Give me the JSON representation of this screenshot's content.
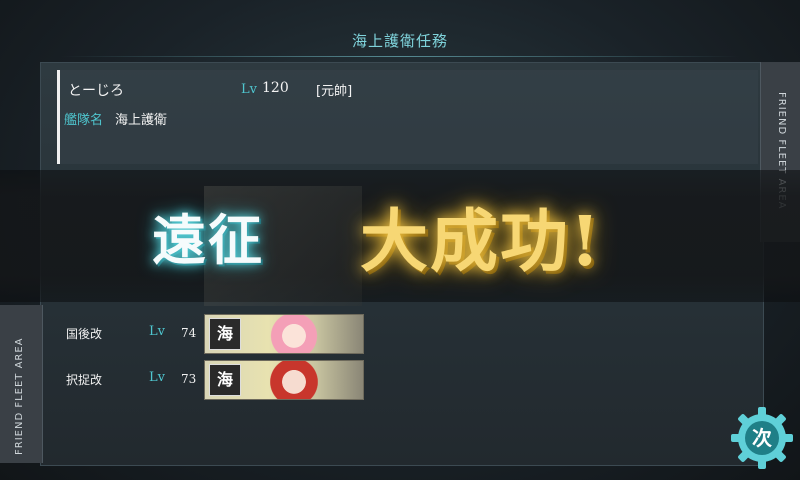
{
  "mission_title": "海上護衛任務",
  "player": {
    "name": "とーじろ",
    "lv_label": "Lv",
    "lv_value": "120",
    "rank": "[元帥]"
  },
  "fleet": {
    "label": "艦隊名",
    "name": "海上護衛"
  },
  "side_labels": {
    "left": "FRIEND FLEET AREA",
    "right": "FRIEND FLEET AREA"
  },
  "result": {
    "expedition": "遠征",
    "great_success": "大成功!"
  },
  "ships": [
    {
      "name": "国後改",
      "lv_label": "Lv",
      "lv": "74",
      "badge": "海防",
      "hair_color": "#f49fb7"
    },
    {
      "name": "択捉改",
      "lv_label": "Lv",
      "lv": "73",
      "badge": "海防",
      "hair_color": "#c8362c"
    }
  ],
  "next_button": {
    "label": "次"
  },
  "colors": {
    "accent_cyan": "#4fc6cf",
    "gold": "#f7d774",
    "panel": "#263036"
  }
}
